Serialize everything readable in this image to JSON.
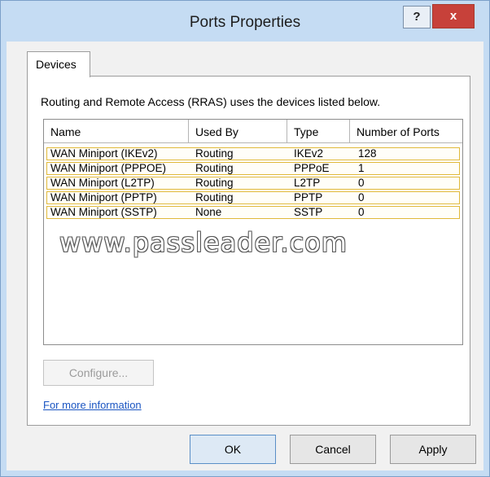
{
  "window": {
    "title": "Ports Properties",
    "help_label": "?",
    "close_label": "x"
  },
  "tabs": [
    {
      "label": "Devices",
      "selected": true
    }
  ],
  "devices": {
    "description": "Routing and Remote Access (RRAS) uses the devices listed below.",
    "columns": [
      "Name",
      "Used By",
      "Type",
      "Number of Ports"
    ],
    "rows": [
      {
        "name": "WAN Miniport (IKEv2)",
        "used_by": "Routing",
        "type": "IKEv2",
        "ports": "128"
      },
      {
        "name": "WAN Miniport (PPPOE)",
        "used_by": "Routing",
        "type": "PPPoE",
        "ports": "1"
      },
      {
        "name": "WAN Miniport (L2TP)",
        "used_by": "Routing",
        "type": "L2TP",
        "ports": "0"
      },
      {
        "name": "WAN Miniport (PPTP)",
        "used_by": "Routing",
        "type": "PPTP",
        "ports": "0"
      },
      {
        "name": "WAN Miniport (SSTP)",
        "used_by": "None",
        "type": "SSTP",
        "ports": "0"
      }
    ],
    "configure_label": "Configure...",
    "more_info_label": "For more information"
  },
  "watermark": "www.passleader.com",
  "buttons": {
    "ok": "OK",
    "cancel": "Cancel",
    "apply": "Apply"
  },
  "colors": {
    "title_bar": "#c5dcf3",
    "close_button": "#c7413a",
    "row_highlight_border": "#e0b93a",
    "link": "#1a55c2"
  }
}
